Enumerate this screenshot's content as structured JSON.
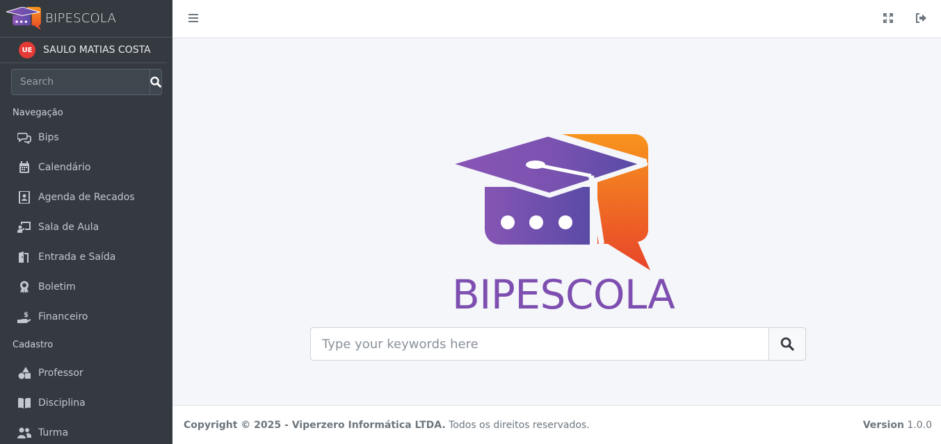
{
  "brand": {
    "name": "BIPESCOLA"
  },
  "user": {
    "initials": "UE",
    "name": "SAULO MATIAS COSTA"
  },
  "sidebar_search": {
    "placeholder": "Search"
  },
  "nav": {
    "section_navegacao": "Navegação",
    "items_navegacao": [
      {
        "label": "Bips",
        "icon": "comments-icon"
      },
      {
        "label": "Calendário",
        "icon": "calendar-icon"
      },
      {
        "label": "Agenda de Recados",
        "icon": "contact-book-icon"
      },
      {
        "label": "Sala de Aula",
        "icon": "chalkboard-teacher-icon"
      },
      {
        "label": "Entrada e Saída",
        "icon": "door-icon"
      },
      {
        "label": "Boletim",
        "icon": "award-icon"
      },
      {
        "label": "Financeiro",
        "icon": "hand-holding-dollar-icon"
      }
    ],
    "section_cadastro": "Cadastro",
    "items_cadastro": [
      {
        "label": "Professor",
        "icon": "shapes-icon"
      },
      {
        "label": "Disciplina",
        "icon": "book-open-icon"
      },
      {
        "label": "Turma",
        "icon": "users-icon"
      }
    ]
  },
  "topbar": {
    "menu_icon": "bars-icon",
    "fullscreen_icon": "expand-icon",
    "logout_icon": "sign-out-icon"
  },
  "main": {
    "logo_title": "BIPESCOLA",
    "keyword_search": {
      "placeholder": "Type your keywords here"
    }
  },
  "footer": {
    "copyright_bold": "Copyright © 2025 - Viperzero Informática LTDA.",
    "copyright_rest": " Todos os direitos reservados.",
    "version_label": "Version",
    "version_value": " 1.0.0"
  },
  "colors": {
    "sidebar_bg": "#343a40",
    "brand_purple": "#7e4fb0",
    "brand_orange": "#f08a24",
    "avatar_red": "#e53935"
  }
}
